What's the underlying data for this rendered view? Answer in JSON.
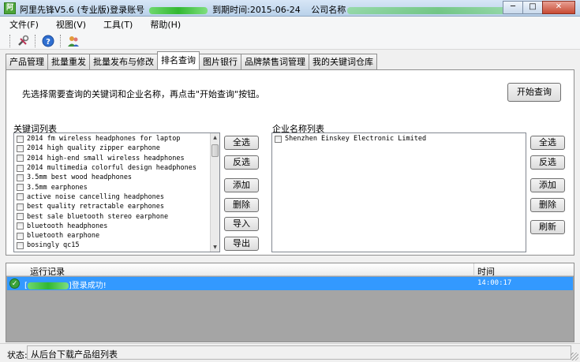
{
  "window": {
    "title_prefix": "阿里先锋V5.6 (专业版)登录账号",
    "title_expire": "到期时间:2015-06-24",
    "title_company": "公司名称",
    "app_icon_letter": "阿",
    "controls": {
      "minimize": "─",
      "maximize": "□",
      "close": "✕"
    }
  },
  "menu": [
    {
      "label": "文件(F)"
    },
    {
      "label": "视图(V)"
    },
    {
      "label": "工具(T)"
    },
    {
      "label": "帮助(H)"
    }
  ],
  "toolbar": {
    "icons": [
      "tools-icon",
      "help-icon",
      "users-icon"
    ]
  },
  "tabs": [
    {
      "label": "产品管理",
      "active": false
    },
    {
      "label": "批量重发",
      "active": false
    },
    {
      "label": "批量发布与修改",
      "active": false
    },
    {
      "label": "排名查询",
      "active": true
    },
    {
      "label": "图片银行",
      "active": false
    },
    {
      "label": "品牌禁售词管理",
      "active": false
    },
    {
      "label": "我的关键词仓库",
      "active": false
    }
  ],
  "ranking": {
    "instruction": "先选择需要查询的关键词和企业名称，再点击\"开始查询\"按钮。",
    "start_button": "开始查询",
    "keyword_list": {
      "label": "关键词列表",
      "items": [
        "2014 fm wireless headphones for laptop",
        "2014 high quality zipper earphone",
        "2014 high-end small wireless headphones",
        "2014 multimedia colorful design headphones",
        "3.5mm best wood headphones",
        "3.5mm earphones",
        "active noise cancelling headphones",
        "best quality retractable earphones",
        "best sale bluetooth stereo earphone",
        "bluetooth  headphones",
        "bluetooth earphone",
        "bosingly qc15"
      ],
      "buttons": {
        "select_all": "全选",
        "invert": "反选",
        "add": "添加",
        "delete": "删除",
        "import": "导入",
        "export": "导出"
      }
    },
    "company_list": {
      "label": "企业名称列表",
      "items": [
        "Shenzhen Einskey Electronic Limited"
      ],
      "buttons": {
        "select_all": "全选",
        "invert": "反选",
        "add": "添加",
        "delete": "删除",
        "refresh": "刷新"
      }
    }
  },
  "log": {
    "col_record": "运行记录",
    "col_time": "时间",
    "rows": [
      {
        "message_prefix": "[",
        "message_suffix": "]登录成功!",
        "time": "14:00:17",
        "status_icon": "check-icon"
      }
    ]
  },
  "statusbar": {
    "label": "状态:",
    "text": "从后台下载产品组列表"
  },
  "colors": {
    "selection": "#3399ff",
    "log_background": "#a5a5a5"
  }
}
